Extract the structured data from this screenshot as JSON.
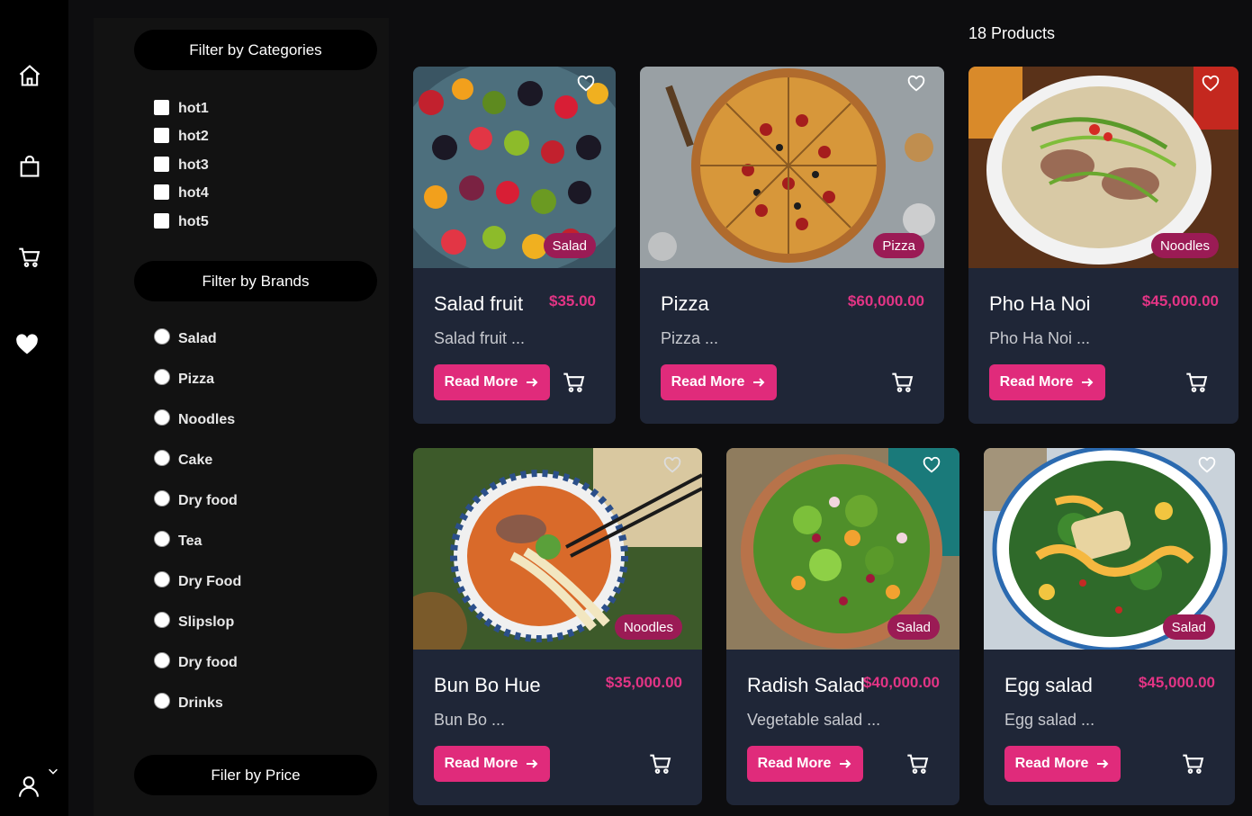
{
  "nav": {
    "items": [
      {
        "icon": "home-icon",
        "label": "Home"
      },
      {
        "icon": "shopping-bag-icon",
        "label": "Shop"
      },
      {
        "icon": "cart-icon",
        "label": "Cart"
      },
      {
        "icon": "heart-icon",
        "label": "Favorites"
      }
    ]
  },
  "filters": {
    "categories_title": "Filter by Categories",
    "categories": [
      "hot1",
      "hot2",
      "hot3",
      "hot4",
      "hot5"
    ],
    "brands_title": "Filter by Brands",
    "brands": [
      "Salad",
      "Pizza",
      "Noodles",
      "Cake",
      "Dry food",
      "Tea",
      "Dry Food",
      "Slipslop",
      "Dry food",
      "Drinks"
    ],
    "price_title": "Filer by Price"
  },
  "products_count": "18 Products",
  "products": [
    {
      "name": "Salad fruit",
      "price": "$35.00",
      "desc": "Salad fruit ...",
      "badge": "Salad",
      "read_more": "Read More"
    },
    {
      "name": "Pizza",
      "price": "$60,000.00",
      "desc": "Pizza ...",
      "badge": "Pizza",
      "read_more": "Read More"
    },
    {
      "name": "Pho Ha Noi",
      "price": "$45,000.00",
      "desc": "Pho Ha Noi ...",
      "badge": "Noodles",
      "read_more": "Read More"
    },
    {
      "name": "Bun Bo Hue",
      "price": "$35,000.00",
      "desc": "Bun Bo ...",
      "badge": "Noodles",
      "read_more": "Read More"
    },
    {
      "name": "Radish Salad",
      "price": "$40,000.00",
      "desc": "Vegetable salad ...",
      "badge": "Salad",
      "read_more": "Read More"
    },
    {
      "name": "Egg salad",
      "price": "$45,000.00",
      "desc": "Egg salad ...",
      "badge": "Salad",
      "read_more": "Read More"
    }
  ],
  "colors": {
    "accent": "#e02b7b",
    "price": "#e33485",
    "badge": "#9b1b55",
    "card": "#1f2637",
    "background": "#0d0d0f"
  }
}
